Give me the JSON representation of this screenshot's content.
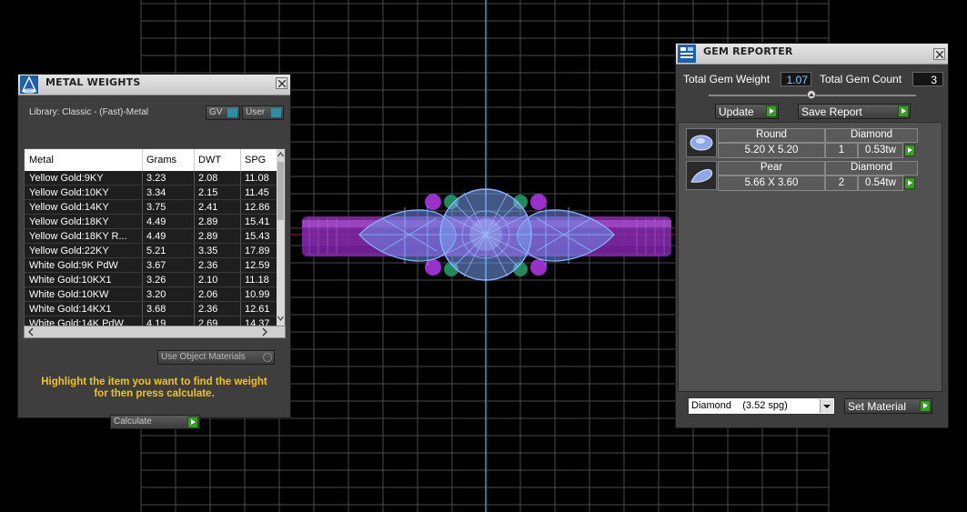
{
  "colors": {
    "background": "#000000",
    "grid": "#4a4a4a",
    "axis": "#33a6b3",
    "ring_band": "#9a2fc0",
    "gem_wire": "#8ab4ff",
    "accent_yellow": "#f0c419",
    "input_text": "#8fd0ff",
    "green_button": "#3f9a2e"
  },
  "metal_weights": {
    "title": "METAL WEIGHTS",
    "icon": "cone-icon",
    "library": "Library: Classic - (Fast)-Metal",
    "gv_label": "GV",
    "user_label": "User",
    "columns": [
      "Metal",
      "Grams",
      "DWT",
      "SPG"
    ],
    "rows": [
      {
        "metal": "Yellow Gold:9KY",
        "grams": "3.23",
        "dwt": "2.08",
        "spg": "11.08"
      },
      {
        "metal": "Yellow Gold:10KY",
        "grams": "3.34",
        "dwt": "2.15",
        "spg": "11.45"
      },
      {
        "metal": "Yellow Gold:14KY",
        "grams": "3.75",
        "dwt": "2.41",
        "spg": "12.86"
      },
      {
        "metal": "Yellow Gold:18KY",
        "grams": "4.49",
        "dwt": "2.89",
        "spg": "15.41"
      },
      {
        "metal": "Yellow Gold:18KY R...",
        "grams": "4.49",
        "dwt": "2.89",
        "spg": "15.43"
      },
      {
        "metal": "Yellow Gold:22KY",
        "grams": "5.21",
        "dwt": "3.35",
        "spg": "17.89"
      },
      {
        "metal": "White Gold:9K PdW",
        "grams": "3.67",
        "dwt": "2.36",
        "spg": "12.59"
      },
      {
        "metal": "White Gold:10KX1",
        "grams": "3.26",
        "dwt": "2.10",
        "spg": "11.18"
      },
      {
        "metal": "White Gold:10KW",
        "grams": "3.20",
        "dwt": "2.06",
        "spg": "10.99"
      },
      {
        "metal": "White Gold:14KX1",
        "grams": "3.68",
        "dwt": "2.36",
        "spg": "12.61"
      },
      {
        "metal": "White Gold:14K PdW",
        "grams": "4.19",
        "dwt": "2.69",
        "spg": "14.37"
      }
    ],
    "use_object_materials": "Use Object Materials",
    "instruction_line1": "Highlight the item you want to find the weight",
    "instruction_line2": "for then press calculate.",
    "calculate_label": "Calculate"
  },
  "gem_reporter": {
    "title": "GEM REPORTER",
    "icon": "report-icon",
    "total_weight_label": "Total Gem Weight",
    "total_weight_value": "1.07",
    "total_count_label": "Total Gem Count",
    "total_count_value": "3",
    "update_label": "Update",
    "save_report_label": "Save Report",
    "gems": [
      {
        "shape": "Round",
        "material": "Diamond",
        "size": "5.20 X 5.20",
        "count": "1",
        "weight": "0.53tw",
        "icon": "round-gem-icon"
      },
      {
        "shape": "Pear",
        "material": "Diamond",
        "size": "5.66 X 3.60",
        "count": "2",
        "weight": "0.54tw",
        "icon": "pear-gem-icon"
      }
    ],
    "material_select": "Diamond    (3.52 spg)",
    "set_material_label": "Set Material"
  }
}
